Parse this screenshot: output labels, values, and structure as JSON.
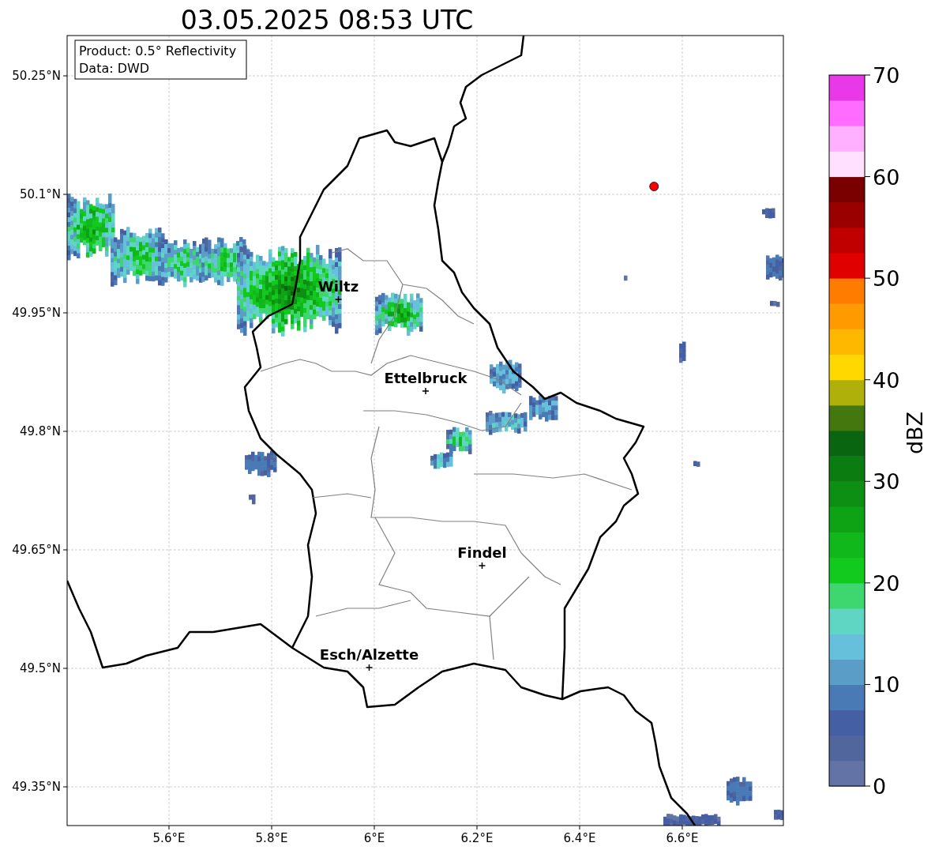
{
  "title": "03.05.2025 08:53 UTC",
  "info_box": [
    "Product: 0.5° Reflectivity",
    "Data: DWD"
  ],
  "map": {
    "latitude_labels": [
      "50.25°N",
      "50.1°N",
      "49.95°N",
      "49.8°N",
      "49.65°N",
      "49.5°N",
      "49.35°N"
    ],
    "longitude_labels": [
      "5.6°E",
      "5.8°E",
      "6°E",
      "6.2°E",
      "6.4°E",
      "6.6°E"
    ],
    "cities": [
      "Wiltz",
      "Ettelbruck",
      "Findel",
      "Esch/Alzette"
    ]
  },
  "colorbar": {
    "label": "dBZ",
    "ticks": [
      "70",
      "60",
      "50",
      "40",
      "30",
      "20",
      "10",
      "0"
    ]
  }
}
